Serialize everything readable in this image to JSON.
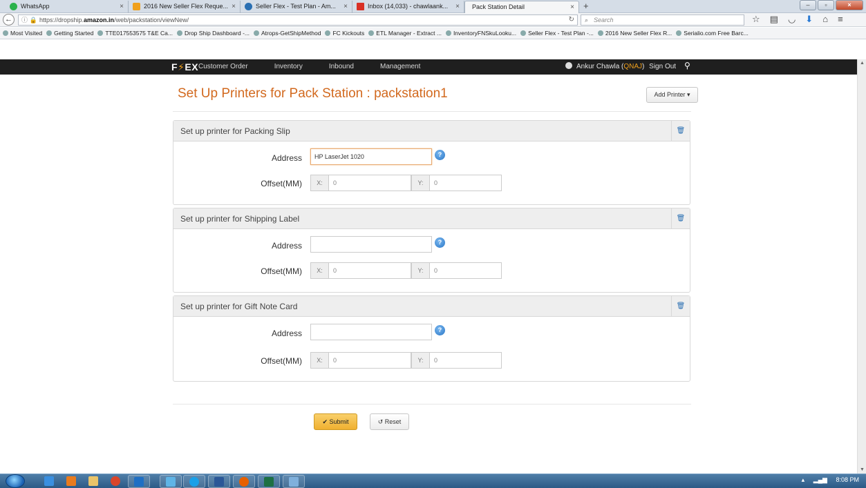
{
  "browser": {
    "tabs": [
      {
        "label": "WhatsApp",
        "icon_color": "#2bb24c"
      },
      {
        "label": "2016 New Seller Flex Reque...",
        "icon_color": "#f0a01c"
      },
      {
        "label": "Seller Flex - Test Plan - Am...",
        "icon_color": "#2a6fb2"
      },
      {
        "label": "Inbox (14,033) - chawlaank...",
        "icon_color": "#d93025"
      },
      {
        "label": "Pack Station Detail",
        "icon_color": ""
      }
    ],
    "new_tab": "+",
    "url_prefix": "https://dropship.",
    "url_domain": "amazon.in",
    "url_path": "/web/packstation/viewNew/",
    "search_placeholder": "Search",
    "bookmarks": [
      "Most Visited",
      "Getting Started",
      "TTE017553575 T&E Ca...",
      "Drop Ship Dashboard -...",
      "Atrops-GetShipMethod",
      "FC Kickouts",
      "ETL Manager - Extract ...",
      "InventoryFNSkuLooku...",
      "Seller Flex - Test Plan -...",
      "2016 New Seller Flex R...",
      "Serialio.com Free Barc..."
    ]
  },
  "app": {
    "logo_left": "F",
    "logo_bolt": "⚡",
    "logo_right": "EX",
    "nav": [
      "Customer Order",
      "Inventory",
      "Inbound",
      "Management"
    ],
    "user_name": "Ankur Chawla (",
    "user_code": "QNAJ",
    "user_close": ")",
    "sign_out": "Sign Out"
  },
  "page": {
    "title": "Set Up Printers for Pack Station : packstation1",
    "add_printer": "Add Printer ▾",
    "address_label": "Address",
    "offset_label": "Offset(MM)",
    "x_prefix": "X:",
    "y_prefix": "Y:",
    "panels": [
      {
        "title": "Set up printer for Packing Slip",
        "address": "HP LaserJet 1020",
        "x": "0",
        "y": "0"
      },
      {
        "title": "Set up printer for Shipping Label",
        "address": "",
        "x": "0",
        "y": "0"
      },
      {
        "title": "Set up printer for Gift Note Card",
        "address": "",
        "x": "0",
        "y": "0"
      }
    ],
    "submit": "✔  Submit",
    "reset": "↺  Reset"
  },
  "taskbar": {
    "clock": "8:08 PM"
  }
}
